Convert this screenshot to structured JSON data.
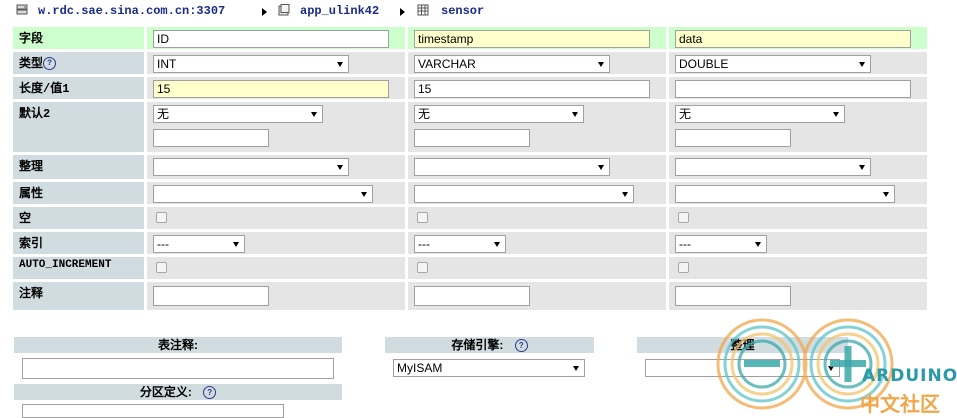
{
  "breadcrumb": {
    "server": "w.rdc.sae.sina.com.cn:3307",
    "database": "app_ulink42",
    "table": "sensor"
  },
  "form": {
    "row_labels": {
      "field": "字段",
      "type": "类型",
      "length": "长度/值1",
      "default": "默认2",
      "collation": "整理",
      "attributes": "属性",
      "null": "空",
      "index": "索引",
      "auto_increment": "AUTO_INCREMENT",
      "comment": "注释"
    },
    "columns": [
      {
        "field": "ID",
        "type": "INT",
        "length": "15",
        "default": "无",
        "default_value": "",
        "collation": "",
        "attributes": "",
        "index": "---",
        "comment": ""
      },
      {
        "field": "timestamp",
        "type": "VARCHAR",
        "length": "15",
        "default": "无",
        "default_value": "",
        "collation": "",
        "attributes": "",
        "index": "---",
        "comment": ""
      },
      {
        "field": "data",
        "type": "DOUBLE",
        "length": "",
        "default": "无",
        "default_value": "",
        "collation": "",
        "attributes": "",
        "index": "---",
        "comment": ""
      }
    ],
    "help_glyph": "?"
  },
  "table_options": {
    "table_comment_label": "表注释:",
    "storage_engine_label": "存储引擎:",
    "storage_engine_value": "MyISAM",
    "collation_label": "整理",
    "collation_value": "",
    "partition_label": "分区定义:"
  },
  "watermark": {
    "line1": "ARDUINO",
    "line2": "中文社区"
  }
}
